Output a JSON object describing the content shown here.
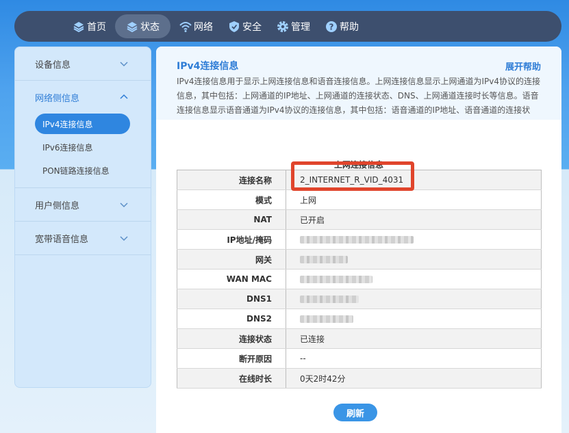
{
  "nav": {
    "items": [
      {
        "label": "首页",
        "icon": "layers-icon"
      },
      {
        "label": "状态",
        "icon": "layers-icon",
        "active": true
      },
      {
        "label": "网络",
        "icon": "wifi-icon"
      },
      {
        "label": "安全",
        "icon": "shield-icon"
      },
      {
        "label": "管理",
        "icon": "gear-icon"
      },
      {
        "label": "帮助",
        "icon": "help-icon"
      }
    ]
  },
  "sidebar": {
    "groups": [
      {
        "label": "设备信息",
        "icon": "chevron-down-icon"
      },
      {
        "label": "网络侧信息",
        "icon": "chevron-up-icon",
        "open": true,
        "items": [
          {
            "label": "IPv4连接信息",
            "active": true
          },
          {
            "label": "IPv6连接信息"
          },
          {
            "label": "PON链路连接信息"
          }
        ]
      },
      {
        "label": "用户侧信息",
        "icon": "chevron-down-icon"
      },
      {
        "label": "宽带语音信息",
        "icon": "chevron-down-icon"
      }
    ]
  },
  "help": {
    "title": "IPv4连接信息",
    "expand_label": "展开帮助",
    "text": "IPv4连接信息用于显示上网连接信息和语音连接信息。上网连接信息显示上网通道为IPv4协议的连接信息，其中包括：上网通道的IP地址、上网通道的连接状态、DNS、上网通道连接时长等信息。语音连接信息显示语音通道为IPv4协议的连接信息，其中包括：语音通道的IP地址、语音通道的连接状"
  },
  "table": {
    "caption": "上网连接信息",
    "rows": [
      {
        "label": "连接名称",
        "value": "2_INTERNET_R_VID_4031"
      },
      {
        "label": "模式",
        "value": "上网"
      },
      {
        "label": "NAT",
        "value": "已开启"
      },
      {
        "label": "IP地址/掩码",
        "value": "",
        "blurred": true
      },
      {
        "label": "网关",
        "value": "",
        "blurred": true
      },
      {
        "label": "WAN MAC",
        "value": "",
        "blurred": true
      },
      {
        "label": "DNS1",
        "value": "",
        "blurred": true
      },
      {
        "label": "DNS2",
        "value": "",
        "blurred": true
      },
      {
        "label": "连接状态",
        "value": "已连接"
      },
      {
        "label": "断开原因",
        "value": "--"
      },
      {
        "label": "在线时长",
        "value": "0天2时42分"
      }
    ]
  },
  "refresh_label": "刷新",
  "colors": {
    "accent": "#2f86e0",
    "nav_bg": "#3d4f6e",
    "highlight": "#e0452c"
  }
}
